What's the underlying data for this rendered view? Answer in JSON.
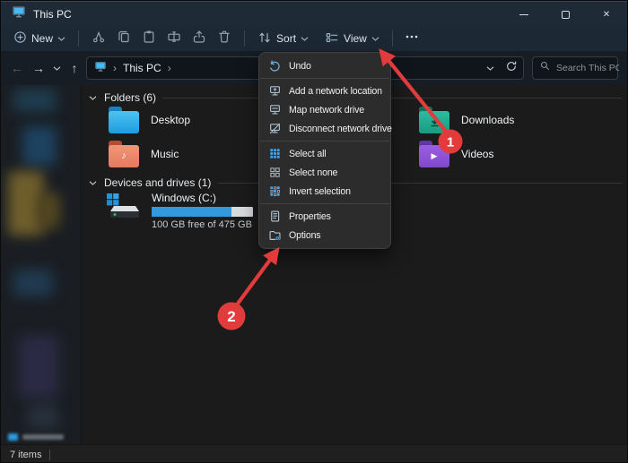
{
  "titlebar": {
    "title": "This PC"
  },
  "toolbar": {
    "new_label": "New",
    "sort_label": "Sort",
    "view_label": "View"
  },
  "navbar": {
    "breadcrumb": "This PC",
    "search_placeholder": "Search This PC"
  },
  "menu": {
    "items": [
      {
        "label": "Undo",
        "icon": "undo-icon"
      },
      {
        "label": "Add a network location",
        "icon": "add-network-location-icon"
      },
      {
        "label": "Map network drive",
        "icon": "map-network-drive-icon"
      },
      {
        "label": "Disconnect network drive",
        "icon": "disconnect-network-drive-icon"
      },
      {
        "label": "Select all",
        "icon": "select-all-icon"
      },
      {
        "label": "Select none",
        "icon": "select-none-icon"
      },
      {
        "label": "Invert selection",
        "icon": "invert-selection-icon"
      },
      {
        "label": "Properties",
        "icon": "properties-icon"
      },
      {
        "label": "Options",
        "icon": "options-icon"
      }
    ]
  },
  "content": {
    "group_folders_label": "Folders (6)",
    "group_drives_label": "Devices and drives (1)",
    "folders": [
      {
        "name": "Desktop"
      },
      {
        "name": "Downloads"
      },
      {
        "name": "Music"
      },
      {
        "name": "Videos"
      }
    ],
    "drive": {
      "name": "Windows (C:)",
      "capacity_text": "100 GB free of 475 GB",
      "percent_used": 79
    }
  },
  "statusbar": {
    "items_count": "7 items"
  },
  "annotations": {
    "step1_label": "1",
    "step2_label": "2",
    "arrow_color": "#e23b3b"
  },
  "colors": {
    "chrome_blue": "#1e2a36",
    "menu_bg": "#2c2c2c",
    "accent_blue": "#3398dc"
  }
}
